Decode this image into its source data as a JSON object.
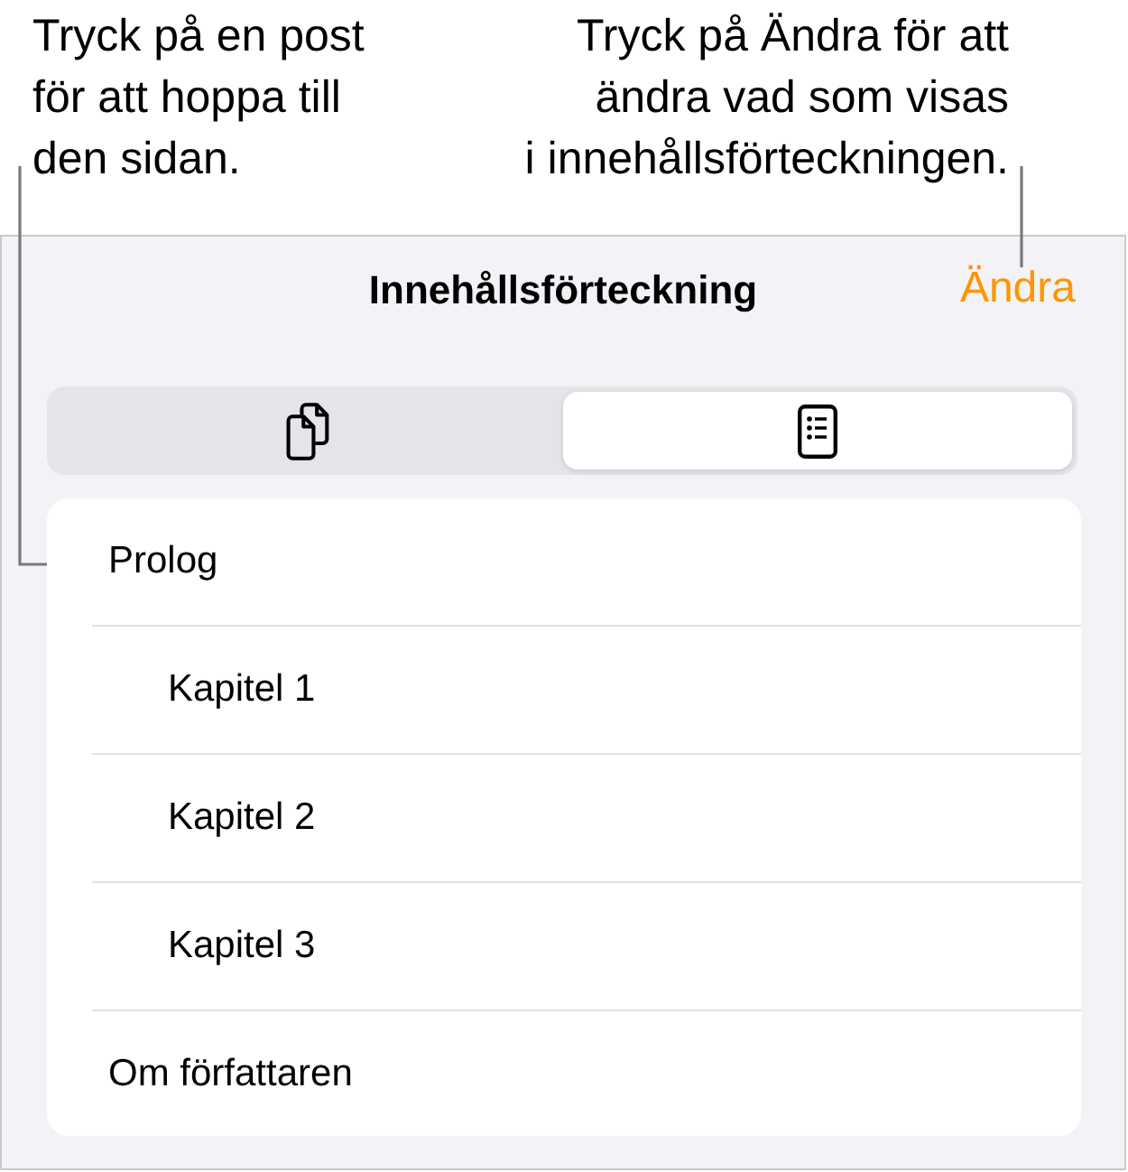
{
  "callouts": [
    "Tryck på en post\nför att hoppa till\nden sidan.",
    "Tryck på Ändra för att\nändra vad som visas\ni innehållsförteckningen."
  ],
  "navigation_bar": {
    "title": "Innehållsförteckning",
    "edit_button": "Ändra"
  },
  "view_switcher": [
    {
      "kind": "thumbnails",
      "selected": false
    },
    {
      "kind": "contents",
      "selected": true
    }
  ],
  "contents": [
    {
      "label": "Prolog",
      "children": [
        {
          "label": "Kapitel 1"
        },
        {
          "label": "Kapitel 2"
        },
        {
          "label": "Kapitel 3"
        }
      ]
    },
    {
      "label": "Om författaren"
    }
  ]
}
